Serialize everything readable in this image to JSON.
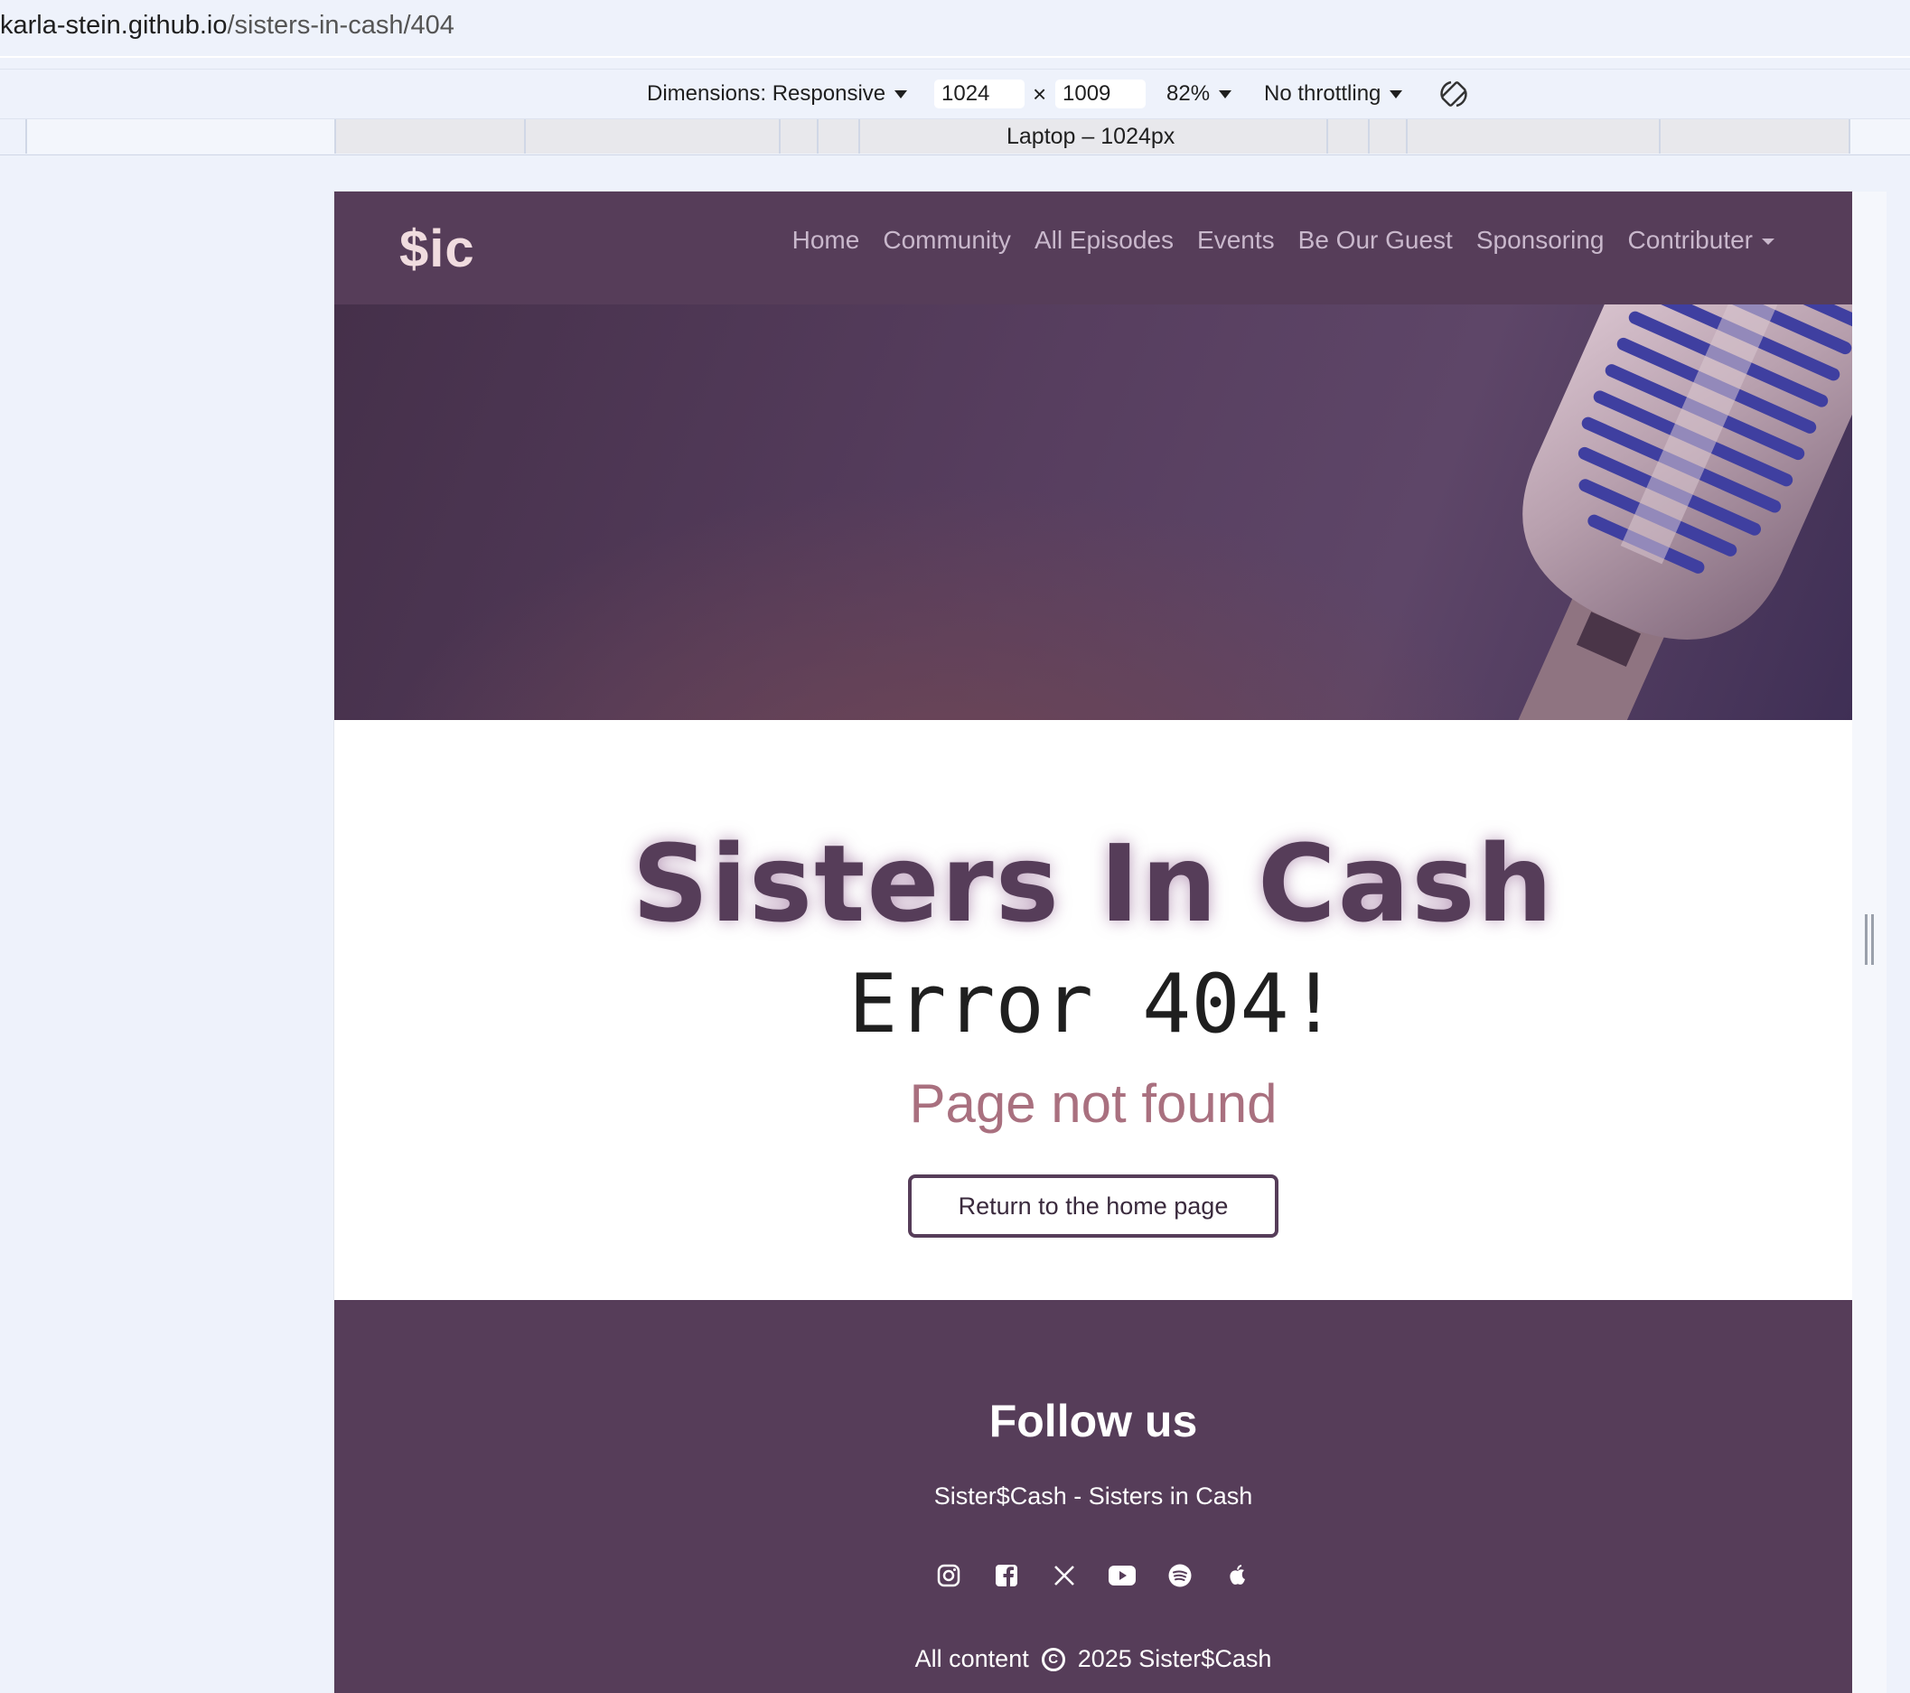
{
  "browser": {
    "url_host": "karla-stein.github.io",
    "url_path": "/sisters-in-cash/404"
  },
  "devtools": {
    "dimensions_label": "Dimensions: Responsive",
    "width_value": "1024",
    "times": "×",
    "height_value": "1009",
    "zoom": "82%",
    "throttling": "No throttling",
    "media_label": "Laptop – 1024px"
  },
  "site": {
    "logo": "$ic",
    "nav": [
      "Home",
      "Community",
      "All Episodes",
      "Events",
      "Be Our Guest",
      "Sponsoring",
      "Contributer"
    ],
    "brand_title": "Sisters In Cash",
    "error_title": "Error 404!",
    "subtitle": "Page not found",
    "home_button": "Return to the home page",
    "footer": {
      "follow": "Follow us",
      "tagline": "Sister$Cash - Sisters in Cash",
      "socials": [
        "instagram-icon",
        "facebook-icon",
        "x-icon",
        "youtube-icon",
        "spotify-icon",
        "apple-icon"
      ],
      "copyright_prefix": "All content",
      "copyright_symbol": "C",
      "copyright_suffix": "2025 Sister$Cash"
    }
  }
}
